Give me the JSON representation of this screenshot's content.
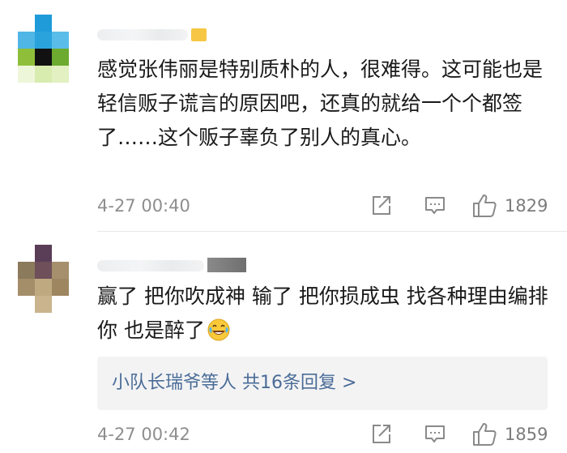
{
  "comments": [
    {
      "content": "感觉张伟丽是特别质朴的人，很难得。这可能也是轻信贩子谎言的原因吧，还真的就给一个个都签了……这个贩子辜负了别人的真心。",
      "timestamp": "4-27 00:40",
      "likes": "1829"
    },
    {
      "content": "赢了 把你吹成神 输了 把你损成虫 找各种理由编排你 也是醉了",
      "emoji": "laugh-cry-emoji",
      "replies": {
        "user": "小队长瑞爷",
        "middle": "等人 ",
        "count_text": "共16条回复",
        "arrow": ">"
      },
      "timestamp": "4-27 00:42",
      "likes": "1859"
    }
  ],
  "colors": {
    "link": "#4a6c97",
    "text": "#1a1a1a",
    "meta": "#8e8e8e",
    "reply_bg": "#f3f3f4"
  },
  "icons": {
    "share": "share-icon",
    "reply": "comment-icon",
    "like": "thumbs-up-icon"
  }
}
